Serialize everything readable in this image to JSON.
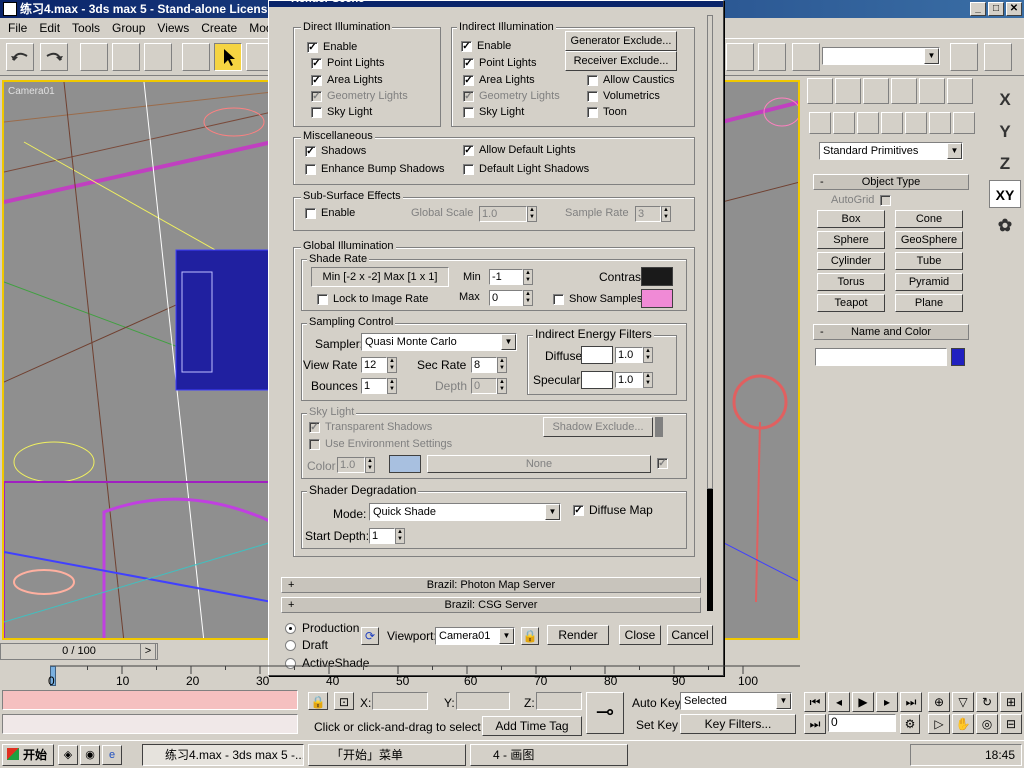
{
  "window": {
    "title": "练习4.max - 3ds max 5 - Stand-alone Licens",
    "min": "_",
    "max": "□",
    "close": "✕"
  },
  "menu": [
    "File",
    "Edit",
    "Tools",
    "Group",
    "Views",
    "Create",
    "Modifiers"
  ],
  "viewport": {
    "label": "Camera01"
  },
  "dialog": {
    "title": "Render Scene",
    "direct": {
      "legend": "Direct Illumination",
      "enable": "Enable",
      "point": "Point Lights",
      "area": "Area Lights",
      "geometry": "Geometry Lights",
      "sky": "Sky Light"
    },
    "indirect": {
      "legend": "Indirect Illumination",
      "enable": "Enable",
      "point": "Point Lights",
      "area": "Area Lights",
      "geometry": "Geometry Lights",
      "sky": "Sky Light",
      "gen_exclude": "Generator Exclude...",
      "rec_exclude": "Receiver Exclude...",
      "caustics": "Allow Caustics",
      "volumetrics": "Volumetrics",
      "toon": "Toon"
    },
    "misc": {
      "legend": "Miscellaneous",
      "shadows": "Shadows",
      "enhance": "Enhance Bump Shadows",
      "allow_default": "Allow Default Lights",
      "default_shadows": "Default Light Shadows"
    },
    "sss": {
      "legend": "Sub-Surface Effects",
      "enable": "Enable",
      "scale_label": "Global Scale",
      "scale": "1.0",
      "rate_label": "Sample Rate",
      "rate": "3"
    },
    "gi": {
      "legend": "Global Illumination",
      "shade_rate_legend": "Shade Rate",
      "shade_rate_text": "Min [-2 x -2]  Max [1 x 1]",
      "lock": "Lock to Image Rate",
      "min_label": "Min",
      "min": "-1",
      "max_label": "Max",
      "max": "0",
      "contrast_label": "Contrast",
      "contrast_color": "#1a1a1a",
      "show_samples": "Show Samples",
      "samples_color": "#f08ad6",
      "sampling_legend": "Sampling Control",
      "sampler_label": "Sampler:",
      "sampler": "Quasi Monte Carlo",
      "view_rate_label": "View Rate",
      "view_rate": "12",
      "sec_rate_label": "Sec Rate",
      "sec_rate": "8",
      "bounces_label": "Bounces",
      "bounces": "1",
      "depth_label": "Depth",
      "depth": "0",
      "energy_legend": "Indirect Energy Filters",
      "diffuse_label": "Diffuse",
      "diffuse": "1.0",
      "specular_label": "Specular",
      "specular": "1.0",
      "sky_legend": "Sky Light",
      "transparent": "Transparent Shadows",
      "use_env": "Use Environment Settings",
      "shadow_exclude": "Shadow Exclude...",
      "color_label": "Color",
      "color_value": "1.0",
      "sky_color": "#a8c0e0",
      "none": "None",
      "degrade_legend": "Shader Degradation",
      "mode_label": "Mode:",
      "mode": "Quick Shade",
      "diffuse_map": "Diffuse Map",
      "start_depth_label": "Start Depth:",
      "start_depth": "1"
    },
    "rollouts": [
      "Brazil: Photon Map Server",
      "Brazil: CSG Server"
    ],
    "footer": {
      "production": "Production",
      "draft": "Draft",
      "activeshade": "ActiveShade",
      "viewport_label": "Viewport:",
      "viewport": "Camera01",
      "render": "Render",
      "close": "Close",
      "cancel": "Cancel"
    }
  },
  "panel": {
    "category": "Standard Primitives",
    "object_type": "Object Type",
    "autogrid": "AutoGrid",
    "buttons": [
      "Box",
      "Cone",
      "Sphere",
      "GeoSphere",
      "Cylinder",
      "Tube",
      "Torus",
      "Pyramid",
      "Teapot",
      "Plane"
    ],
    "name_color": "Name and Color",
    "object_color": "#2020c0"
  },
  "axes": [
    "X",
    "Y",
    "Z",
    "XY"
  ],
  "timeline": {
    "frame": "0 / 100",
    "ticks": [
      "0",
      "10",
      "20",
      "30",
      "40",
      "50",
      "60",
      "70",
      "80",
      "90",
      "100"
    ]
  },
  "status": {
    "x": "X:",
    "y": "Y:",
    "z": "Z:",
    "prompt": "Click or click-and-drag to select obj",
    "add_tag": "Add Time Tag",
    "auto_key": "Auto Key",
    "set_key": "Set Key",
    "selected": "Selected",
    "key_filters": "Key Filters...",
    "frame": "0"
  },
  "taskbar": {
    "start": "开始",
    "tasks": [
      "练习4.max - 3ds max 5 -...",
      "「开始」菜单",
      "4 - 画图"
    ],
    "time": "18:45"
  }
}
